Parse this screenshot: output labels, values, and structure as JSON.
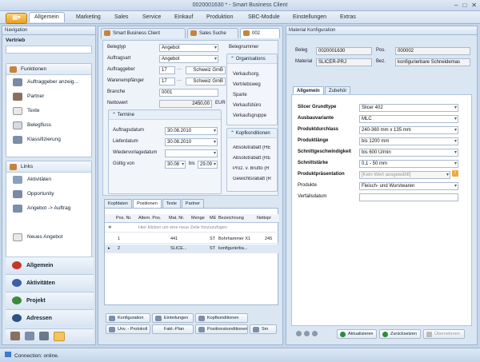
{
  "window": {
    "title": "0020001630 * - ",
    "app": "Smart Business Client"
  },
  "menu": {
    "items": [
      "Allgemein",
      "Marketing",
      "Sales",
      "Service",
      "Einkauf",
      "Produktion",
      "SBC-Module",
      "Einstellungen",
      "Extras"
    ]
  },
  "nav": {
    "title": "Navigation",
    "section": "Vertrieb",
    "funktionen_title": "Funktionen",
    "funktionen": [
      "Auftraggeber anzeig...",
      "Partner",
      "Texte",
      "Belegfluss",
      "Klassifizierung"
    ],
    "links_title": "Links",
    "links": [
      "Aktivitäten",
      "Opportunity",
      "Angebot -> Auftrag",
      "",
      "Neues Angebot"
    ],
    "big": [
      "Allgemein",
      "Aktivitäten",
      "Projekt",
      "Adressen"
    ]
  },
  "status": {
    "text": "Connection: online."
  },
  "doc_tabs": [
    "Smart Business Client",
    "Sales Suche",
    "002"
  ],
  "form": {
    "belegtyp_l": "Belegtyp",
    "belegtyp": "Angebot",
    "auftragsart_l": "Auftragsart",
    "auftragsart": "Angebot",
    "auftraggeber_l": "Auftraggeber",
    "auftraggeber": "17",
    "auftraggeber_name": "Schweiz GmB",
    "warenempf_l": "Warenempfänger",
    "warenempf": "17",
    "warenempf_name": "Schweiz GmB",
    "branche_l": "Branche",
    "branche": "0001",
    "netto_l": "Nettowert",
    "netto": "2450,00",
    "waehrung": "EUR",
    "termine": "Termine",
    "auftragsdatum_l": "Auftragsdatum",
    "auftragsdatum": "30.08.2010",
    "lieferdatum_l": "Lieferdatum",
    "lieferdatum": "30.08.2010",
    "wiedervorlage_l": "Wiedervorlagedatum",
    "wiedervorlage": "",
    "gueltig_l": "Gültig von",
    "gueltig_von": "30.08",
    "bis_l": "bis",
    "gueltig_bis": "29.09",
    "belegnummer_l": "Belegnummer",
    "org_title": "Organisations",
    "org": [
      "Verkaufsorg.",
      "Vertriebsweg",
      "Sparte",
      "Verkaufsbüro",
      "Verkaufsgruppe"
    ],
    "kopf_title": "Kopfkonditionen",
    "kopf": [
      "Absolutrabatt (HE",
      "Absolutrabatt (RE",
      "Proz. v. Brutto (R",
      "Gewichtsrabatt (R"
    ]
  },
  "grid": {
    "tabs": [
      "Kopfdaten",
      "Positionen",
      "Texte",
      "Partner"
    ],
    "headers": [
      "Pos. Nr.",
      "Altern. Pos.",
      "Mat. Nr.",
      "Menge",
      "ME",
      "Bezeichnung",
      "Nettopr"
    ],
    "group_hint": "Hier klicken um eine neue Zeile hinzuzufügen",
    "rows": [
      {
        "pos": "1",
        "alt": "",
        "mat": "441",
        "menge": "",
        "me": "ST",
        "bez": "Bohrhammer X1",
        "netto": "245"
      },
      {
        "pos": "2",
        "alt": "",
        "mat": "SLICE...",
        "menge": "",
        "me": "ST",
        "bez": "konfigurierba...",
        "netto": ""
      }
    ]
  },
  "buttons": [
    "Konfiguration",
    "Einteilungen",
    "Kopfkonditionen",
    "Unv. - Protokoll",
    "Fakt.-Plan",
    "Positionskonditionen",
    "Sm"
  ],
  "config": {
    "title": "Material Konfiguration",
    "beleg_l": "Beleg",
    "beleg": "0020001630",
    "pos_l": "Pos.",
    "pos": "000002",
    "material_l": "Material",
    "material": "SLICER-PRJ",
    "bez_l": "Bez.",
    "bez": "konfigurierbare Schneidemas",
    "tabs": [
      "Allgemein",
      "Zubehör"
    ],
    "fields": [
      {
        "label": "Slicer Grundtype",
        "value": "Slicer 402",
        "bold": true
      },
      {
        "label": "Ausbauvariante",
        "value": "MLC",
        "bold": true
      },
      {
        "label": "Produktdurchlass",
        "value": "240-360 mm x 135 mm",
        "bold": true
      },
      {
        "label": "Produktlänge",
        "value": "bis 1200 mm",
        "bold": true
      },
      {
        "label": "Schnittgeschwindigkeit",
        "value": "bis 600 U/min",
        "bold": true
      },
      {
        "label": "Schnittstärke",
        "value": "0,1 - 50 mm",
        "bold": true
      },
      {
        "label": "Produktpräsentation",
        "value": "[Kein Wert ausgewählt]",
        "bold": true
      },
      {
        "label": "Produkte",
        "value": "Fleisch- und Wurstwaren",
        "bold": false
      },
      {
        "label": "Verfallsdatum",
        "value": "",
        "bold": false
      }
    ],
    "btn_aktualisieren": "Aktualisieren",
    "btn_zurueck": "Zurücksetzen",
    "btn_uebernehmen": "Übernehmen"
  },
  "colors": {
    "accent": "#f2a93b",
    "panel": "#dbe6f3",
    "border": "#9fb5d0"
  }
}
